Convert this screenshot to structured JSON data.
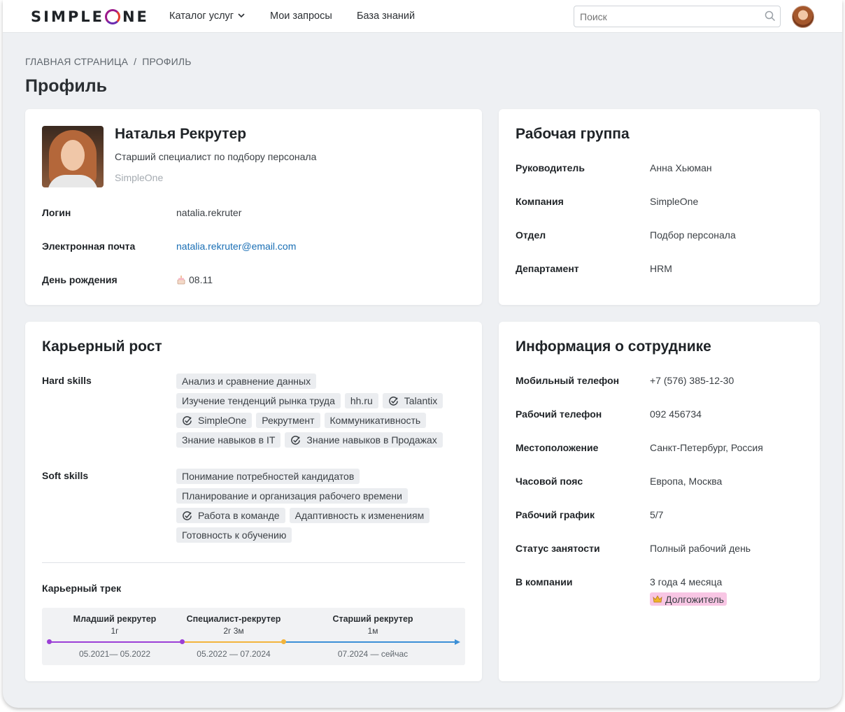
{
  "header": {
    "logo": "SIMPLEONE",
    "logo_left": "SIMPLE",
    "logo_right": "NE",
    "nav": [
      "Каталог услуг",
      "Мои запросы",
      "База знаний"
    ],
    "search_placeholder": "Поиск"
  },
  "breadcrumb": {
    "home": "ГЛАВНАЯ СТРАНИЦА",
    "separator": "/",
    "current": "ПРОФИЛЬ"
  },
  "page_title": "Профиль",
  "profile": {
    "name": "Наталья Рекрутер",
    "position": "Старший специалист по подбору персонала",
    "company": "SimpleOne",
    "fields": [
      {
        "label": "Логин",
        "value": "natalia.rekruter"
      },
      {
        "label": "Электронная почта",
        "value": "natalia.rekruter@email.com"
      },
      {
        "label": "День рождения",
        "value": "08.11",
        "icon": "cake-icon"
      }
    ]
  },
  "workgroup": {
    "title": "Рабочая группа",
    "fields": [
      {
        "label": "Руководитель",
        "value": "Анна Хьюман"
      },
      {
        "label": "Компания",
        "value": "SimpleOne"
      },
      {
        "label": "Отдел",
        "value": "Подбор персонала"
      },
      {
        "label": "Департамент",
        "value": "HRM"
      }
    ]
  },
  "career": {
    "title": "Карьерный рост",
    "hard_label": "Hard skills",
    "hard_skills": [
      {
        "text": "Анализ и сравнение данных",
        "verified": false
      },
      {
        "text": "Изучение тенденций рынка труда",
        "verified": false
      },
      {
        "text": "hh.ru",
        "verified": false
      },
      {
        "text": "Talantix",
        "verified": true
      },
      {
        "text": "SimpleOne",
        "verified": true
      },
      {
        "text": "Рекрутмент",
        "verified": false
      },
      {
        "text": "Коммуникативность",
        "verified": false
      },
      {
        "text": "Знание навыков в IT",
        "verified": false
      },
      {
        "text": "Знание навыков в Продажах",
        "verified": true
      }
    ],
    "soft_label": "Soft skills",
    "soft_skills": [
      {
        "text": "Понимание потребностей кандидатов",
        "verified": false
      },
      {
        "text": "Планирование и организация рабочего времени",
        "verified": false
      },
      {
        "text": "Работа в команде",
        "verified": true
      },
      {
        "text": "Адаптивность к изменениям",
        "verified": false
      },
      {
        "text": "Готовность к обучению",
        "verified": false
      }
    ],
    "track_label": "Карьерный трек",
    "track": [
      {
        "name": "Младший рекрутер",
        "duration": "1г",
        "dates": "05.2021— 05.2022",
        "color": "#9b3fd6"
      },
      {
        "name": "Специалист-рекрутер",
        "duration": "2г 3м",
        "dates": "05.2022 — 07.2024",
        "color": "#f2b43c"
      },
      {
        "name": "Старший рекрутер",
        "duration": "1м",
        "dates": "07.2024 — сейчас",
        "color": "#3b8fd6"
      }
    ]
  },
  "employee": {
    "title": "Информация о сотруднике",
    "fields": [
      {
        "label": "Мобильный телефон",
        "value": "+7 (576) 385-12-30"
      },
      {
        "label": "Рабочий телефон",
        "value": "092 456734"
      },
      {
        "label": "Местоположение",
        "value": "Санкт-Петербург, Россия"
      },
      {
        "label": "Часовой пояс",
        "value": "Европа, Москва"
      },
      {
        "label": "Рабочий график",
        "value": "5/7"
      },
      {
        "label": "Статус занятости",
        "value": "Полный рабочий день"
      },
      {
        "label": "В компании",
        "value": "3 года 4 месяца"
      }
    ],
    "badge": "Долгожитель",
    "badge_icon": "crown-icon"
  }
}
